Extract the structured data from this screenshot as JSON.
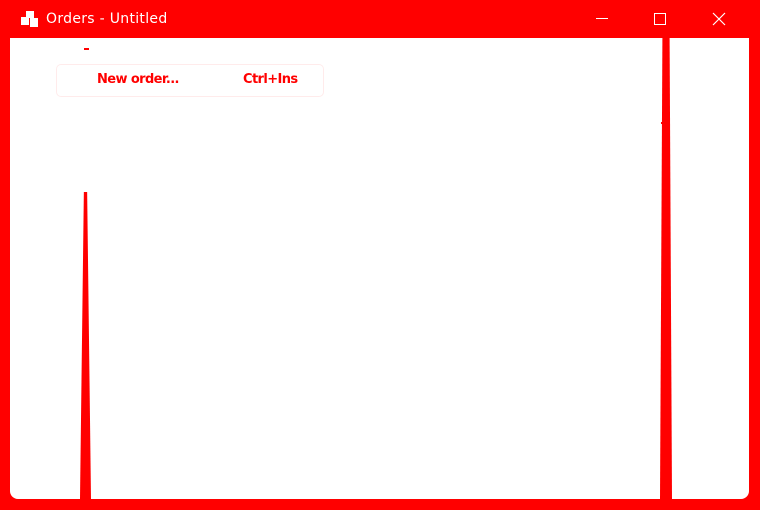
{
  "window": {
    "title": "Orders - Untitled",
    "icon": "app-puzzle-icon",
    "controls": {
      "minimize": "minimize-icon",
      "maximize": "maximize-icon",
      "close": "close-icon"
    }
  },
  "menu": {
    "items": [
      {
        "label": "New order...",
        "shortcut": "Ctrl+Ins"
      }
    ]
  },
  "colors": {
    "accent": "#ff0000",
    "background": "#ffffff"
  }
}
